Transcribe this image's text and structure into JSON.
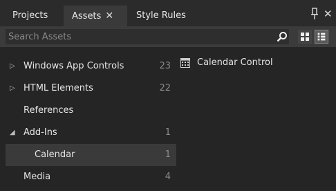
{
  "tabs": {
    "projects_label": "Projects",
    "assets_label": "Assets",
    "assets_close_glyph": "✕",
    "style_rules_label": "Style Rules",
    "panel_close_glyph": "✕"
  },
  "search": {
    "placeholder": "Search Assets",
    "value": ""
  },
  "tree": [
    {
      "label": "Windows App Controls",
      "count": "23",
      "expander": "▷"
    },
    {
      "label": "HTML Elements",
      "count": "22",
      "expander": "▷"
    },
    {
      "label": "References",
      "count": "",
      "expander": ""
    },
    {
      "label": "Add-Ins",
      "count": "1",
      "expander": "◢"
    },
    {
      "label": "Calendar",
      "count": "1",
      "expander": ""
    },
    {
      "label": "Media",
      "count": "4",
      "expander": ""
    }
  ],
  "assets": [
    {
      "label": "Calendar Control",
      "icon": "calendar-control-icon"
    }
  ],
  "colors": {
    "background": "#252526",
    "tabbar": "#2b2b2b",
    "active_tab": "#3a3a3a",
    "search_row": "#3b3b3b",
    "selected_row": "#3a3a3a"
  }
}
